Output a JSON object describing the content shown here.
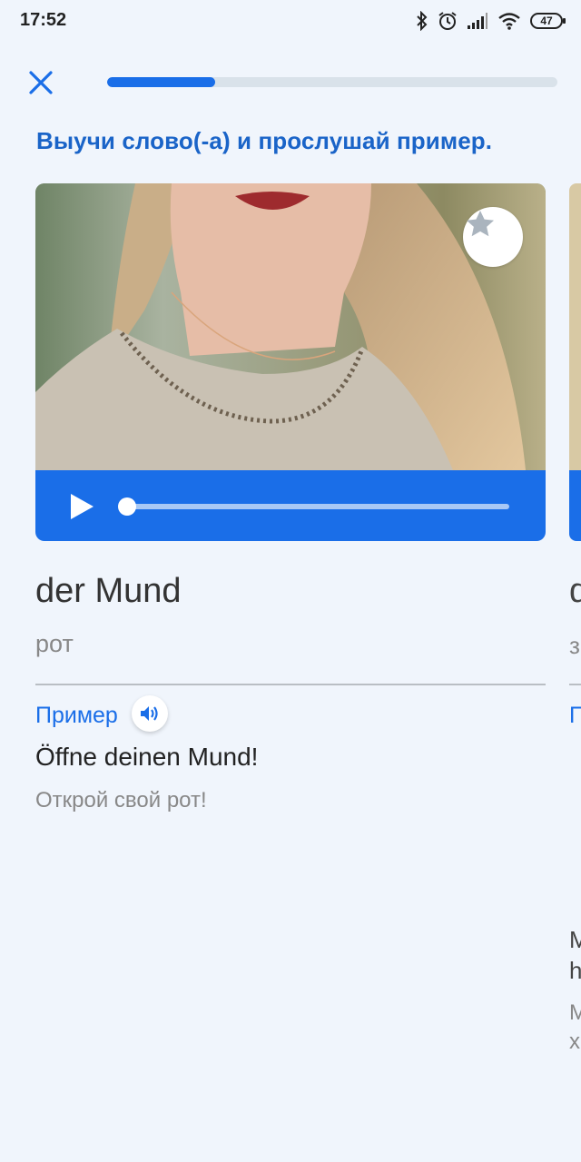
{
  "status_bar": {
    "time": "17:52",
    "battery": "47"
  },
  "lesson": {
    "progress": 0.24,
    "instruction": "Выучи слово(-а) и прослушай пример."
  },
  "card": {
    "word": "der Mund",
    "translation": "рот",
    "example_label": "Пример",
    "example_text": "Öffne deinen Mund!",
    "example_translation": "Открой свой рот!"
  },
  "next_card_peek": {
    "word_initial": "d",
    "translation_initial": "з",
    "example_label_initial": "П",
    "example_line1_initial": "M",
    "example_line2_initial": "h",
    "translation_line1_initial": "M",
    "translation_line2_initial": "х"
  },
  "colors": {
    "accent": "#1a6ee8",
    "title": "#1a64c8",
    "background": "#f0f5fc"
  }
}
